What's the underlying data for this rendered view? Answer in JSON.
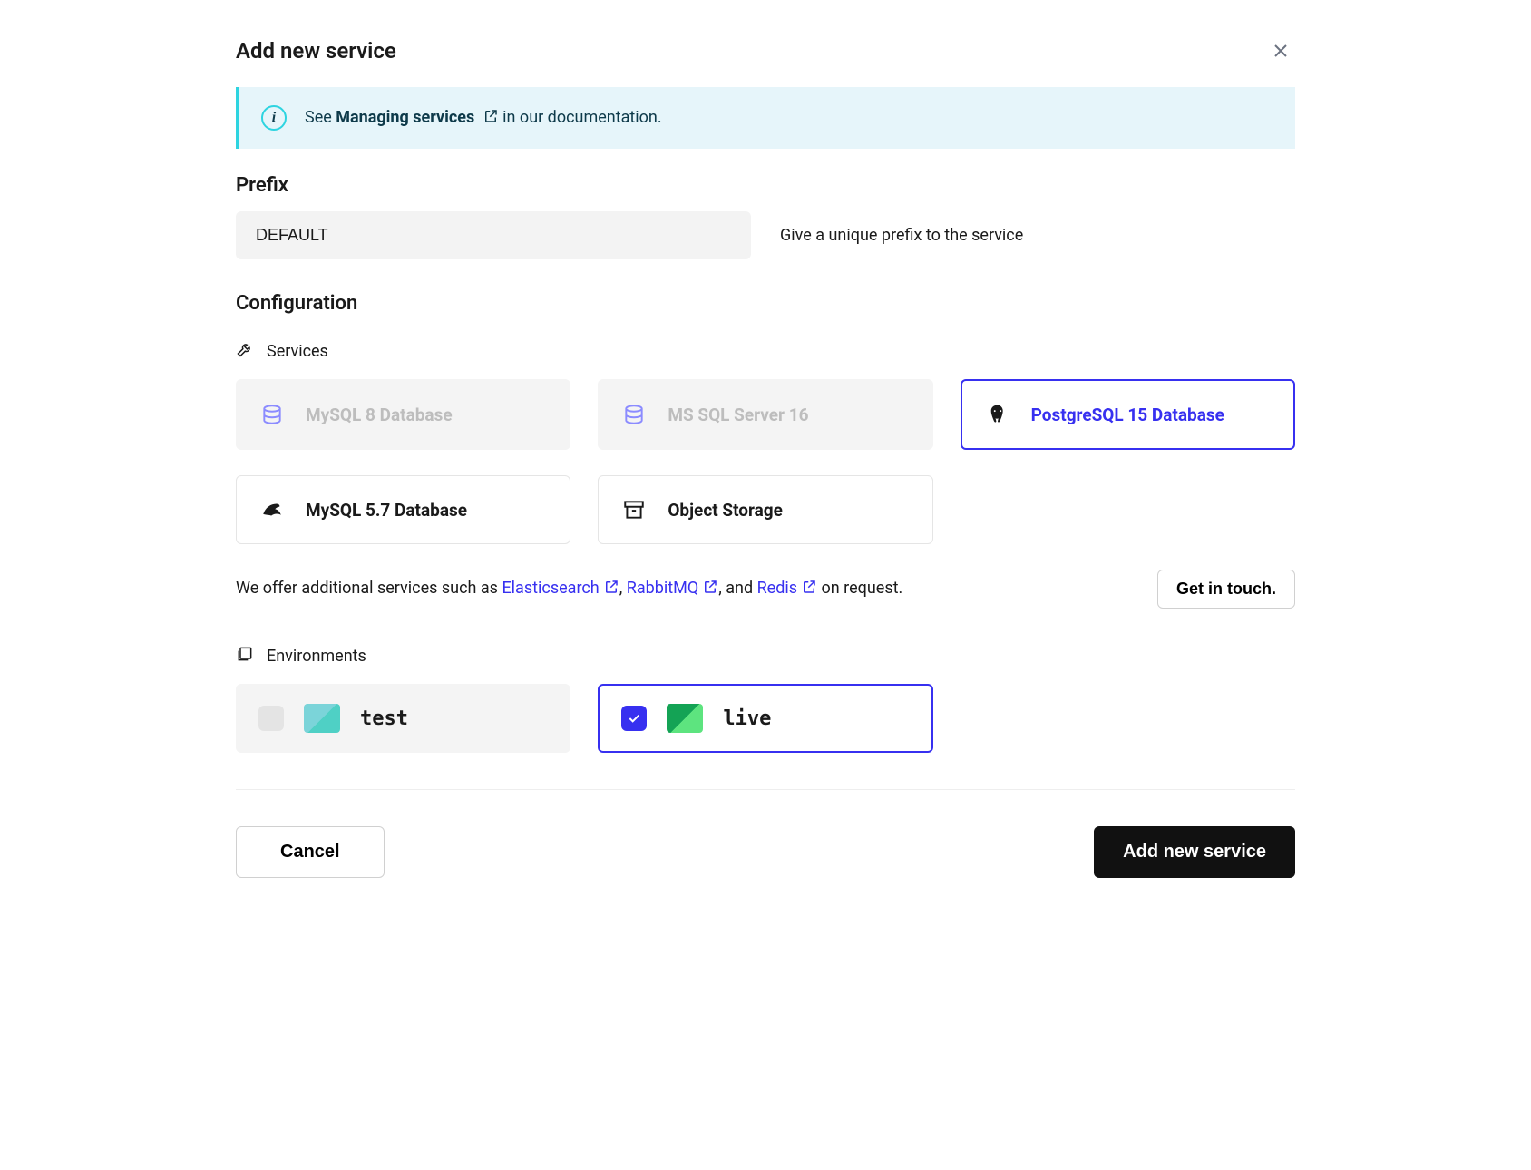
{
  "header": {
    "title": "Add new service"
  },
  "banner": {
    "prefix": "See ",
    "link": "Managing services",
    "suffix": " in our documentation."
  },
  "prefix": {
    "label": "Prefix",
    "value": "DEFAULT",
    "help": "Give a unique prefix to the service"
  },
  "config": {
    "label": "Configuration",
    "services_label": "Services",
    "environments_label": "Environments"
  },
  "services": [
    {
      "label": "MySQL 8 Database",
      "state": "disabled",
      "icon": "db-outline"
    },
    {
      "label": "MS SQL Server 16",
      "state": "disabled",
      "icon": "db-outline"
    },
    {
      "label": "PostgreSQL 15 Database",
      "state": "selected",
      "icon": "postgres"
    },
    {
      "label": "MySQL 5.7 Database",
      "state": "normal",
      "icon": "dolphin"
    },
    {
      "label": "Object Storage",
      "state": "normal",
      "icon": "archive"
    }
  ],
  "additional": {
    "prefix": "We offer additional services such as ",
    "links": [
      "Elasticsearch",
      "RabbitMQ",
      "Redis"
    ],
    "mid1": ", ",
    "mid2": ", and ",
    "suffix": " on request.",
    "button": "Get in touch."
  },
  "environments": [
    {
      "label": "test",
      "selected": false
    },
    {
      "label": "live",
      "selected": true
    }
  ],
  "footer": {
    "cancel": "Cancel",
    "submit": "Add new service"
  }
}
